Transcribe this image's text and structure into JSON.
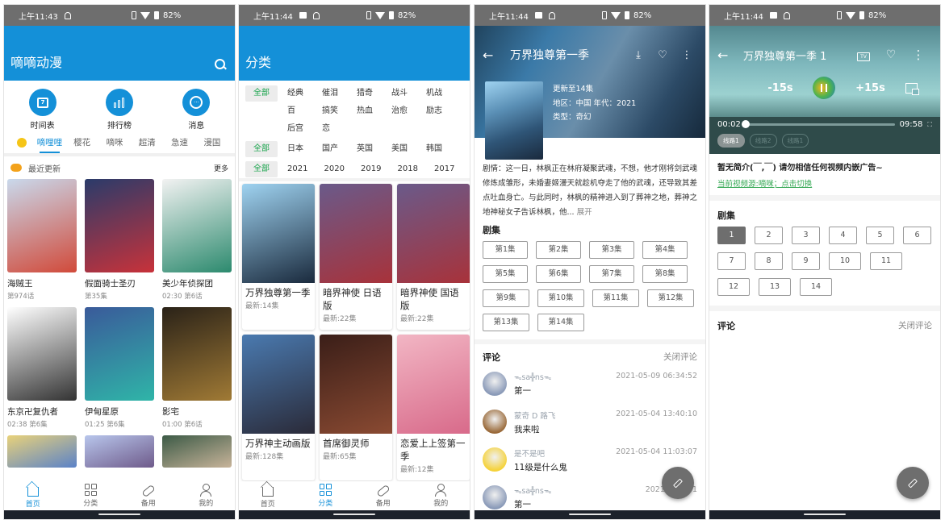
{
  "status": {
    "p1_time": "上午11:43",
    "time": "上午11:44",
    "battery": "82%"
  },
  "home": {
    "title": "嘀嘀动漫",
    "quick": [
      {
        "label": "时间表",
        "icon": "calendar-icon"
      },
      {
        "label": "排行榜",
        "icon": "ranking-icon"
      },
      {
        "label": "消息",
        "icon": "message-icon"
      }
    ],
    "tabs": [
      "嘀哩哩",
      "樱花",
      "嘀咪",
      "超清",
      "急速",
      "漫国"
    ],
    "active_tab": "嘀哩哩",
    "section_title": "最近更新",
    "more": "更多",
    "items": [
      {
        "name": "海贼王",
        "ep": "第974话",
        "color1": "#c9d9ec",
        "color2": "#d14a3a"
      },
      {
        "name": "假面骑士圣刃",
        "ep": "第35集",
        "color1": "#2a3b6a",
        "color2": "#c8323a"
      },
      {
        "name": "美少年侦探团",
        "ep": "02:30 第6话",
        "color1": "#f2f2f2",
        "color2": "#2c8a6e"
      },
      {
        "name": "东京卍复仇者",
        "ep": "02:38 第6集",
        "color1": "#ffffff",
        "color2": "#333333"
      },
      {
        "name": "伊甸星原",
        "ep": "01:25 第6集",
        "color1": "#3a5a9a",
        "color2": "#2fb5a8"
      },
      {
        "name": "影宅",
        "ep": "01:00 第6话",
        "color1": "#2a2218",
        "color2": "#a07a35"
      },
      {
        "name": "",
        "ep": "",
        "color1": "#e9d27a",
        "color2": "#5a82c8"
      },
      {
        "name": "",
        "ep": "",
        "color1": "#b8c6ec",
        "color2": "#6e5a8a"
      },
      {
        "name": "",
        "ep": "",
        "color1": "#3c5a46",
        "color2": "#c8b49a"
      }
    ]
  },
  "category": {
    "title": "分类",
    "all_label": "全部",
    "genres": [
      "经典",
      "催泪",
      "猎奇",
      "战斗",
      "机战",
      "百",
      "搞笑",
      "热血",
      "治愈",
      "励志",
      "后宫",
      "恋"
    ],
    "regions": [
      "日本",
      "国产",
      "英国",
      "美国",
      "韩国"
    ],
    "years": [
      "2021",
      "2020",
      "2019",
      "2018",
      "2017"
    ],
    "items": [
      {
        "name": "万界独尊第一季",
        "ep": "最新:14集",
        "color1": "#9fd3f1",
        "color2": "#1a2a3d"
      },
      {
        "name": "暗界神使 日语版",
        "ep": "最新:22集",
        "color1": "#6a5a8a",
        "color2": "#a8323a"
      },
      {
        "name": "暗界神使 国语版",
        "ep": "最新:22集",
        "color1": "#6a5a8a",
        "color2": "#a8323a"
      },
      {
        "name": "万界神主动画版",
        "ep": "最新:128集",
        "color1": "#4a7ab0",
        "color2": "#2a2a38"
      },
      {
        "name": "首席御灵师",
        "ep": "最新:65集",
        "color1": "#3a1e18",
        "color2": "#8a4a32"
      },
      {
        "name": "恋爱上上签第一季",
        "ep": "最新:12集",
        "color1": "#f2b6c4",
        "color2": "#d86a8a"
      }
    ]
  },
  "detail": {
    "title": "万界独尊第一季",
    "updated": "更新至14集",
    "region_year": "地区：中国 年代：2021",
    "genre": "类型：奇幻",
    "synopsis": "剧情：这一日，林枫正在林府凝聚武魂，不想，他才刚将剑武魂修炼成雏形，未婚妻姬漫天就趁机夺走了他的武魂，还导致其差点吐血身亡。与此同时，林枫的精神进入到了葬神之地，葬神之地神秘女子告诉林枫，他...",
    "expand": "展开",
    "episodes_label": "剧集",
    "episodes": [
      "第1集",
      "第2集",
      "第3集",
      "第4集",
      "第5集",
      "第6集",
      "第7集",
      "第8集",
      "第9集",
      "第10集",
      "第11集",
      "第12集",
      "第13集",
      "第14集"
    ],
    "comments_label": "评论",
    "close_comments": "关闭评论",
    "comments": [
      {
        "user": "ᯓsa╬nsᯓ",
        "time": "2021-05-09 06:34:52",
        "text": "第一",
        "avatar": "#8a9ab8"
      },
      {
        "user": "蒙奇 D 路飞",
        "time": "2021-05-04 13:40:10",
        "text": "我来啦",
        "avatar": "#9a6a3a"
      },
      {
        "user": "是不是吧",
        "time": "2021-05-04 11:03:07",
        "text": "11级是什么鬼",
        "avatar": "#f5d23a"
      },
      {
        "user": "ᯓsa╬nsᯓ",
        "time": "2021-05-03 1",
        "text": "第一",
        "avatar": "#8a9ab8"
      }
    ]
  },
  "player": {
    "title": "万界独尊第一季 1",
    "rewind": "-15s",
    "forward": "+15s",
    "current": "00:02",
    "duration": "09:58",
    "progress": 0.003,
    "lines": [
      "线路1",
      "线路2",
      "线路1"
    ],
    "active_line": 0,
    "intro": "暂无简介(￣,￣) 请勿相信任何视频内嵌广告~",
    "source": "当前视频源:嘀咪；点击切换",
    "episodes_label": "剧集",
    "episodes": [
      "1",
      "2",
      "3",
      "4",
      "5",
      "6",
      "7",
      "8",
      "9",
      "10",
      "11",
      "12",
      "13",
      "14"
    ],
    "active_episode": "1",
    "comments_label": "评论",
    "close_comments": "关闭评论"
  },
  "nav": {
    "items": [
      "首页",
      "分类",
      "备用",
      "我的"
    ]
  }
}
